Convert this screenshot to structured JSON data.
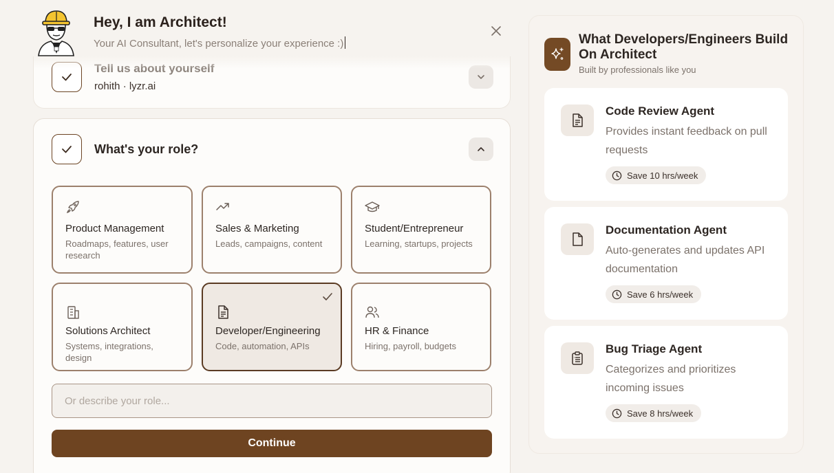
{
  "header": {
    "title": "Hey, I am Architect!",
    "subtitle": "Your AI Consultant, let's personalize your experience :)"
  },
  "step1": {
    "title": "Tell us about yourself",
    "summary": "rohith · lyzr.ai"
  },
  "step2": {
    "title": "What's your role?",
    "roles": [
      {
        "title": "Product Management",
        "desc": "Roadmaps, features, user research",
        "icon": "rocket-icon"
      },
      {
        "title": "Sales & Marketing",
        "desc": "Leads, campaigns, content",
        "icon": "trending-up-icon"
      },
      {
        "title": "Student/Entrepreneur",
        "desc": "Learning, startups, projects",
        "icon": "graduation-cap-icon"
      },
      {
        "title": "Solutions Architect",
        "desc": "Systems, integrations, design",
        "icon": "building-icon"
      },
      {
        "title": "Developer/Engineering",
        "desc": "Code, automation, APIs",
        "icon": "file-text-icon",
        "selected": true
      },
      {
        "title": "HR & Finance",
        "desc": "Hiring, payroll, budgets",
        "icon": "users-icon"
      }
    ],
    "input_placeholder": "Or describe your role...",
    "continue_label": "Continue"
  },
  "sidebar": {
    "title": "What Developers/Engineers Build On Architect",
    "subtitle": "Built by professionals like you",
    "agents": [
      {
        "title": "Code Review Agent",
        "desc": "Provides instant feedback on pull requests",
        "badge": "Save 10 hrs/week",
        "icon": "file-text-icon"
      },
      {
        "title": "Documentation Agent",
        "desc": "Auto-generates and updates API documentation",
        "badge": "Save 6 hrs/week",
        "icon": "file-icon"
      },
      {
        "title": "Bug Triage Agent",
        "desc": "Categorizes and prioritizes incoming issues",
        "badge": "Save 8 hrs/week",
        "icon": "clipboard-list-icon"
      }
    ]
  },
  "colors": {
    "brand": "#6e4421",
    "background": "#f6f3ef",
    "card": "#fdfcfa"
  }
}
